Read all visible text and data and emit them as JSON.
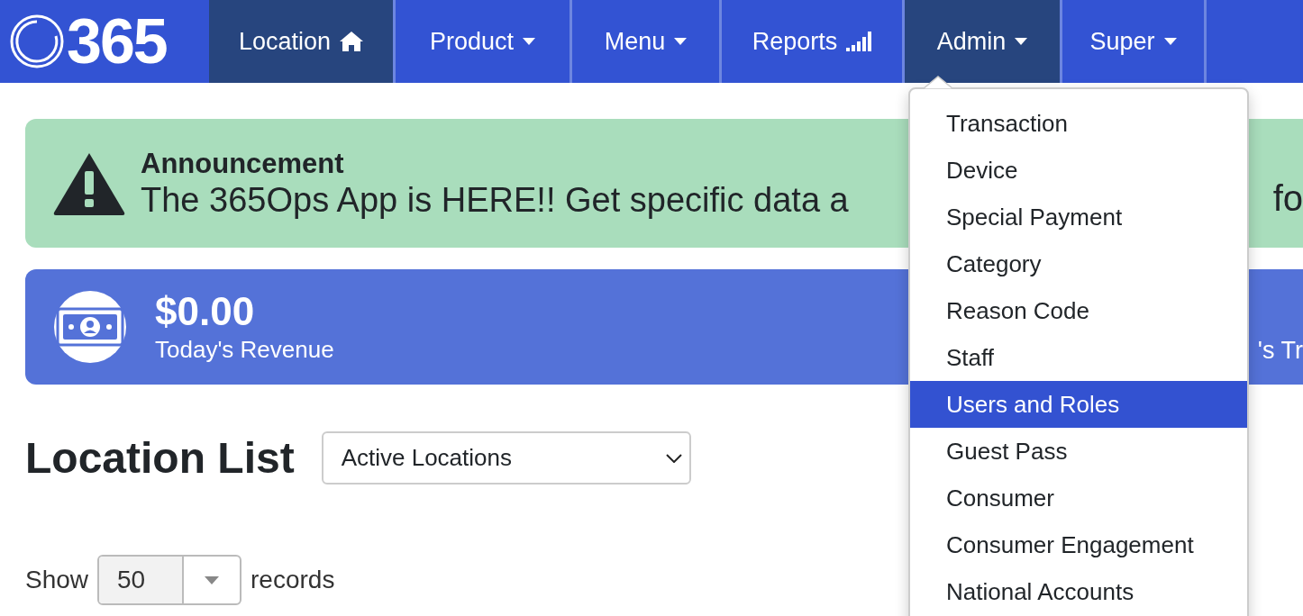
{
  "logo": {
    "text": "365"
  },
  "nav": [
    {
      "label": "Location",
      "kind": "home",
      "active": true
    },
    {
      "label": "Product",
      "kind": "dropdown",
      "active": false
    },
    {
      "label": "Menu",
      "kind": "dropdown",
      "active": false
    },
    {
      "label": "Reports",
      "kind": "reports",
      "active": false
    },
    {
      "label": "Admin",
      "kind": "dropdown",
      "active": true
    },
    {
      "label": "Super",
      "kind": "dropdown",
      "active": false
    }
  ],
  "announcement": {
    "title": "Announcement",
    "text": "The 365Ops App is HERE!! Get specific data a",
    "text_right": "fo"
  },
  "revenue": {
    "amount": "$0.00",
    "label": "Today's Revenue",
    "label_right": "'s Tr"
  },
  "page_title": "Location List",
  "location_filter": {
    "value": "Active Locations"
  },
  "records": {
    "before": "Show",
    "value": "50",
    "after": "records"
  },
  "admin_menu": [
    {
      "label": "Transaction",
      "selected": false
    },
    {
      "label": "Device",
      "selected": false
    },
    {
      "label": "Special Payment",
      "selected": false
    },
    {
      "label": "Category",
      "selected": false
    },
    {
      "label": "Reason Code",
      "selected": false
    },
    {
      "label": "Staff",
      "selected": false
    },
    {
      "label": "Users and Roles",
      "selected": true
    },
    {
      "label": "Guest Pass",
      "selected": false
    },
    {
      "label": "Consumer",
      "selected": false
    },
    {
      "label": "Consumer Engagement",
      "selected": false
    },
    {
      "label": "National Accounts",
      "selected": false
    }
  ]
}
